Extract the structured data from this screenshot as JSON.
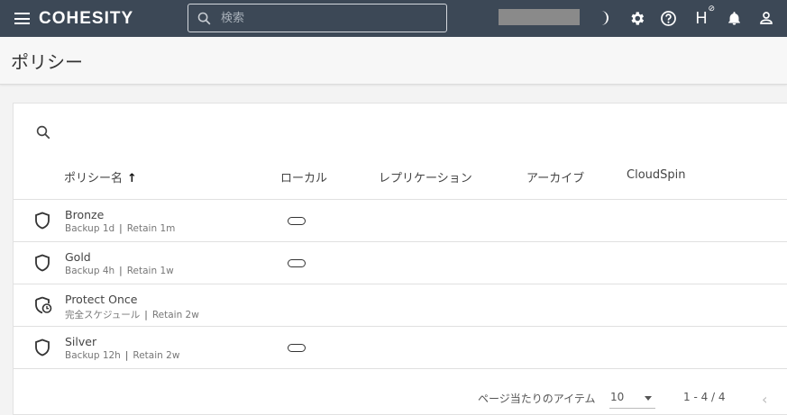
{
  "topbar": {
    "brand": "COHESITY",
    "search_placeholder": "検索",
    "h_label": "H",
    "h_sup": "⊘"
  },
  "page": {
    "title": "ポリシー"
  },
  "table": {
    "columns": {
      "name": "ポリシー名",
      "sort_indicator": "↑",
      "local": "ローカル",
      "replication": "レプリケーション",
      "archive": "アーカイブ",
      "cloudspin": "CloudSpin"
    },
    "rows": [
      {
        "name": "Bronze",
        "meta1": "Backup 1d",
        "meta2": "Retain 1m",
        "icon": "shield-icon",
        "local": true
      },
      {
        "name": "Gold",
        "meta1": "Backup 4h",
        "meta2": "Retain 1w",
        "icon": "shield-icon",
        "local": true
      },
      {
        "name": "Protect Once",
        "meta1": "完全スケジュール",
        "meta2": "Retain 2w",
        "icon": "shield-clock-icon",
        "local": false
      },
      {
        "name": "Silver",
        "meta1": "Backup 12h",
        "meta2": "Retain 2w",
        "icon": "shield-icon",
        "local": true
      }
    ]
  },
  "paginator": {
    "label": "ページ当たりのアイテム",
    "page_size": "10",
    "range": "1 - 4 / 4",
    "prev": "‹"
  },
  "colors": {
    "topbar_bg": "#3c4856",
    "page_bg": "#f3f3f3"
  }
}
